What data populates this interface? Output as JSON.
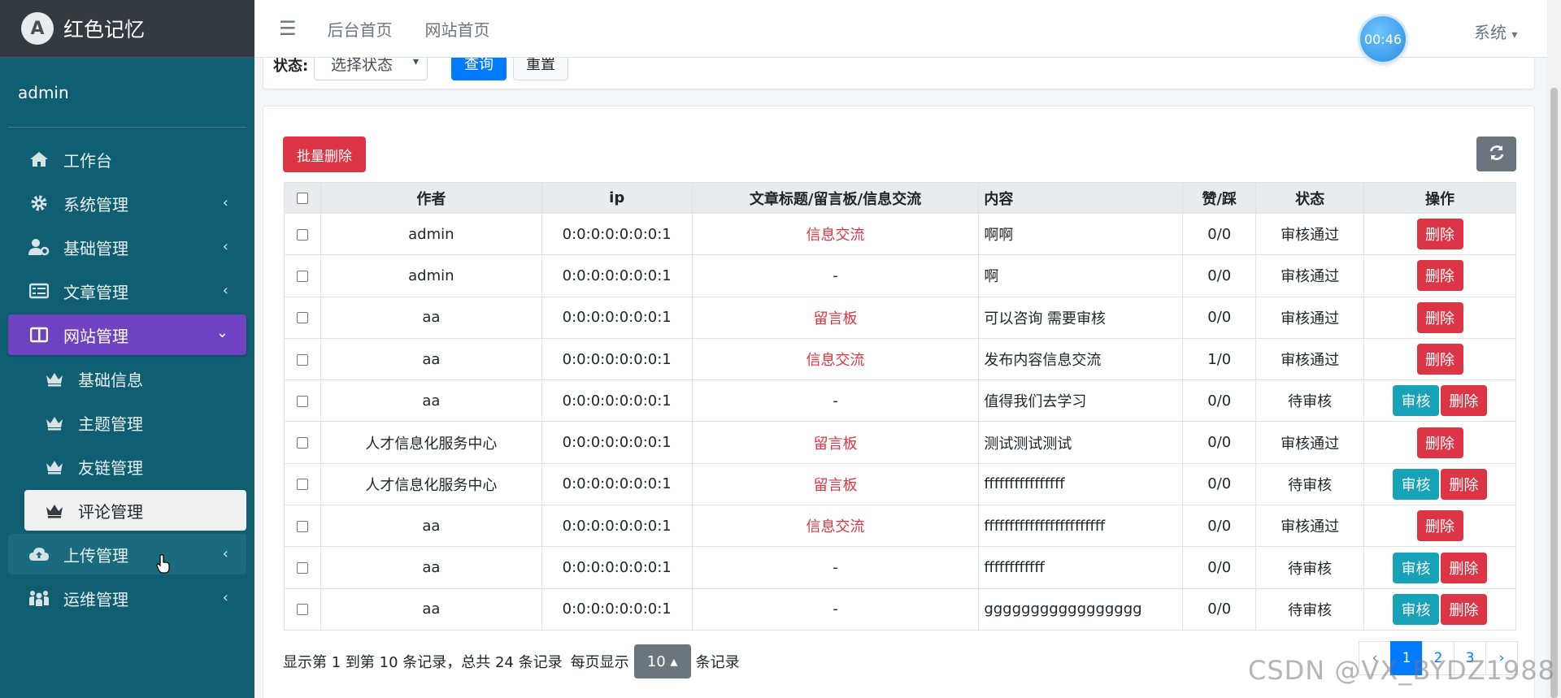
{
  "brand": {
    "title": "红色记忆"
  },
  "user": {
    "name": "admin"
  },
  "sidebar": {
    "items": [
      {
        "label": "工作台",
        "icon": "home-icon"
      },
      {
        "label": "系统管理",
        "icon": "gear-icon"
      },
      {
        "label": "基础管理",
        "icon": "user-gear-icon"
      },
      {
        "label": "文章管理",
        "icon": "list-icon"
      },
      {
        "label": "网站管理",
        "icon": "columns-icon"
      },
      {
        "label": "上传管理",
        "icon": "cloud-upload-icon"
      },
      {
        "label": "运维管理",
        "icon": "people-icon"
      }
    ],
    "sub_items": [
      {
        "label": "基础信息",
        "icon": "crown-icon"
      },
      {
        "label": "主题管理",
        "icon": "crown-icon"
      },
      {
        "label": "友链管理",
        "icon": "crown-icon"
      },
      {
        "label": "评论管理",
        "icon": "crown-icon"
      }
    ],
    "active_color": "#6f42c1",
    "background": "#0f5e72"
  },
  "topbar": {
    "links": [
      "后台首页",
      "网站首页"
    ],
    "timer": "00:46",
    "system_menu": "系统"
  },
  "filter": {
    "status_label": "状态:",
    "status_select": "选择状态",
    "query_button": "查询",
    "reset_button": "重置"
  },
  "toolbar": {
    "batch_delete": "批量删除"
  },
  "table": {
    "headers": [
      "作者",
      "ip",
      "文章标题/留言板/信息交流",
      "内容",
      "赞/踩",
      "状态",
      "操作"
    ],
    "rows": [
      {
        "author": "admin",
        "ip": "0:0:0:0:0:0:0:1",
        "title": "信息交流",
        "content": "啊啊",
        "votes": "0/0",
        "status": "审核通过"
      },
      {
        "author": "admin",
        "ip": "0:0:0:0:0:0:0:1",
        "title": "-",
        "content": "啊",
        "votes": "0/0",
        "status": "审核通过"
      },
      {
        "author": "aa",
        "ip": "0:0:0:0:0:0:0:1",
        "title": "留言板",
        "content": "可以咨询 需要审核",
        "votes": "0/0",
        "status": "审核通过"
      },
      {
        "author": "aa",
        "ip": "0:0:0:0:0:0:0:1",
        "title": "信息交流",
        "content": "发布内容信息交流",
        "votes": "1/0",
        "status": "审核通过"
      },
      {
        "author": "aa",
        "ip": "0:0:0:0:0:0:0:1",
        "title": "-",
        "content": "值得我们去学习",
        "votes": "0/0",
        "status": "待审核"
      },
      {
        "author": "人才信息化服务中心",
        "ip": "0:0:0:0:0:0:0:1",
        "title": "留言板",
        "content": "测试测试测试",
        "votes": "0/0",
        "status": "审核通过"
      },
      {
        "author": "人才信息化服务中心",
        "ip": "0:0:0:0:0:0:0:1",
        "title": "留言板",
        "content": "ffffffffffffffff",
        "votes": "0/0",
        "status": "待审核"
      },
      {
        "author": "aa",
        "ip": "0:0:0:0:0:0:0:1",
        "title": "信息交流",
        "content": "ffffffffffffffffffffffff",
        "votes": "0/0",
        "status": "审核通过"
      },
      {
        "author": "aa",
        "ip": "0:0:0:0:0:0:0:1",
        "title": "-",
        "content": "ffffffffffff",
        "votes": "0/0",
        "status": "待审核"
      },
      {
        "author": "aa",
        "ip": "0:0:0:0:0:0:0:1",
        "title": "-",
        "content": "ggggggggggggggggg",
        "votes": "0/0",
        "status": "待审核"
      }
    ],
    "actions": {
      "audit": "审核",
      "delete": "删除"
    }
  },
  "pagination": {
    "summary": "显示第 1 到第 10 条记录，总共 24 条记录",
    "per_page_prefix": "每页显示",
    "per_page_value": "10 ▴",
    "per_page_suffix": "条记录",
    "prev": "‹",
    "pages": [
      "1",
      "2",
      "3"
    ],
    "next": "›",
    "current": "1"
  },
  "watermark": "CSDN @VX_BYDZ1988"
}
